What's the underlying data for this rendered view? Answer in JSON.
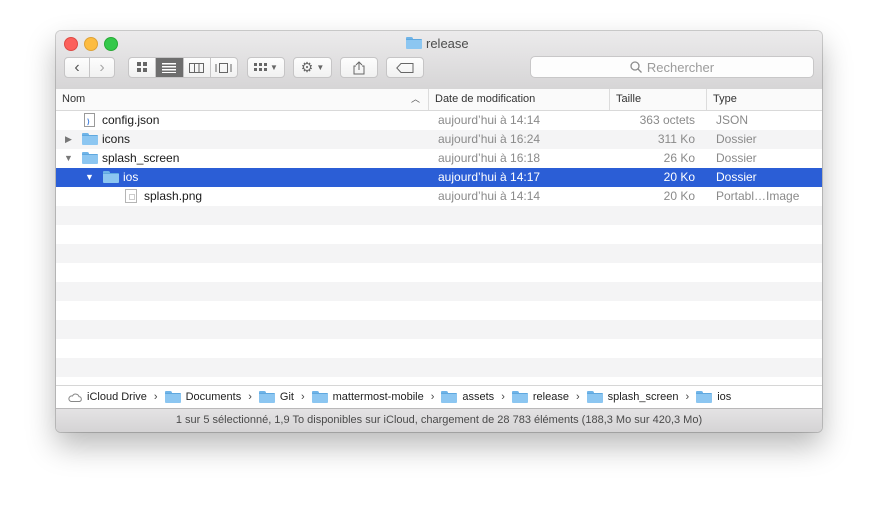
{
  "window": {
    "title": "release"
  },
  "toolbar": {
    "back_label": "‹",
    "forward_label": "›",
    "search_placeholder": "Rechercher"
  },
  "columns": {
    "name": "Nom",
    "date": "Date de modification",
    "size": "Taille",
    "kind": "Type"
  },
  "files": [
    {
      "name": "config.json",
      "date": "aujourd’hui à 14:14",
      "size": "363 octets",
      "kind": "JSON",
      "icon": "json-file-icon",
      "selected": false
    },
    {
      "name": "icons",
      "date": "aujourd’hui à 16:24",
      "size": "311 Ko",
      "kind": "Dossier",
      "icon": "folder-icon",
      "selected": false
    },
    {
      "name": "splash_screen",
      "date": "aujourd’hui à 16:18",
      "size": "26 Ko",
      "kind": "Dossier",
      "icon": "folder-icon",
      "selected": false
    },
    {
      "name": "ios",
      "date": "aujourd’hui à 14:17",
      "size": "20 Ko",
      "kind": "Dossier",
      "icon": "folder-icon",
      "selected": true
    },
    {
      "name": "splash.png",
      "date": "aujourd’hui à 14:14",
      "size": "20 Ko",
      "kind": "Portabl…Image",
      "icon": "image-file-icon",
      "selected": false
    }
  ],
  "path": [
    "iCloud Drive",
    "Documents",
    "Git",
    "mattermost-mobile",
    "assets",
    "release",
    "splash_screen",
    "ios"
  ],
  "status": "1 sur 5 sélectionné, 1,9 To disponibles sur iCloud, chargement de 28 783 éléments (188,3 Mo sur 420,3 Mo)",
  "colors": {
    "selection": "#2b5ed6",
    "folder": "#8cc6f1"
  }
}
